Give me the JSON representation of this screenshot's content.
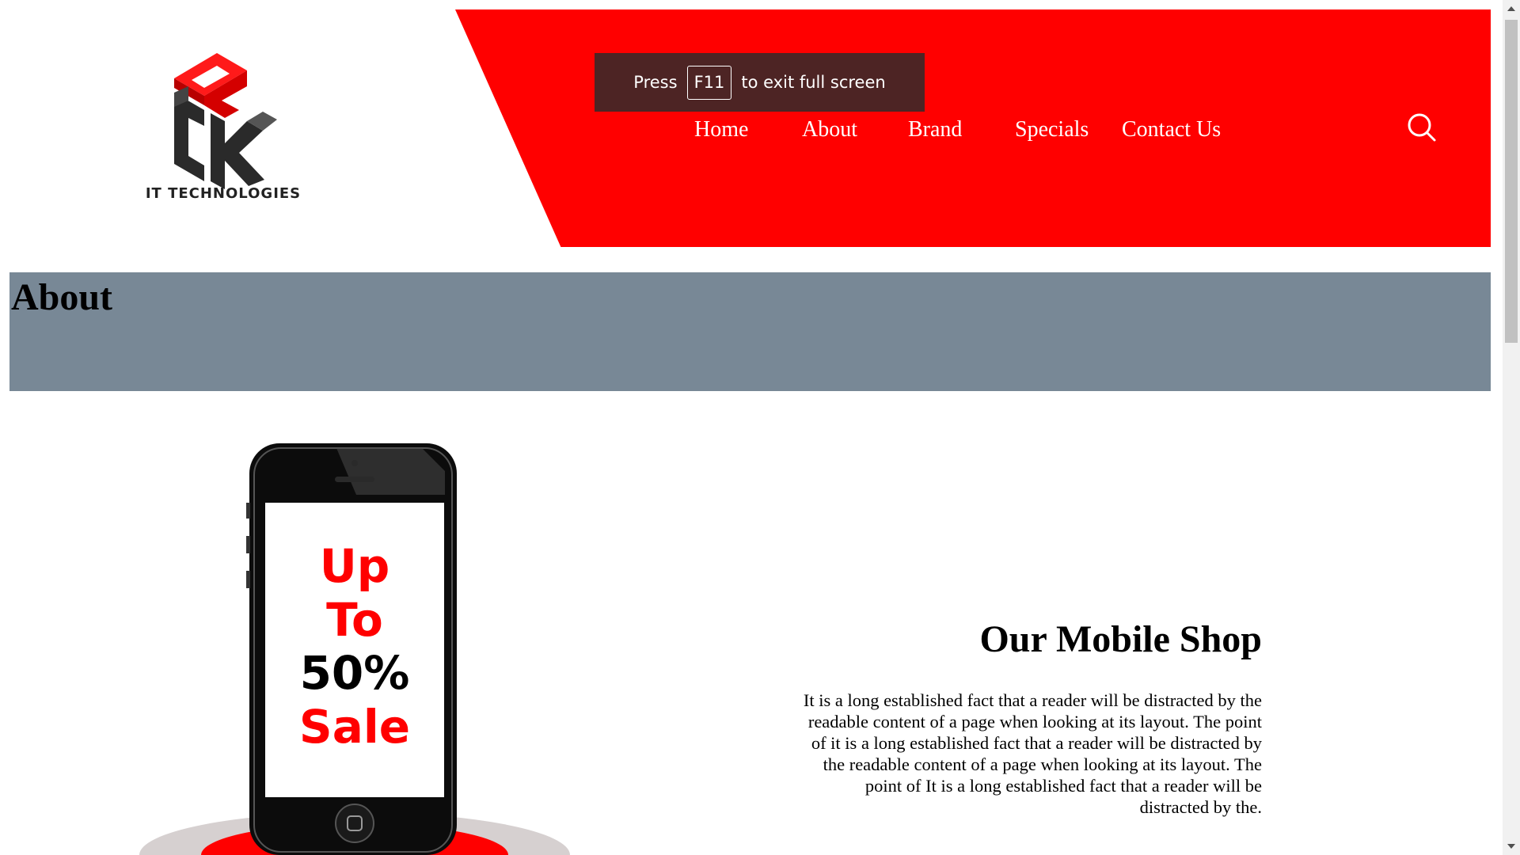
{
  "brand": {
    "logo_text": "IT TECHNOLOGIES",
    "colors": {
      "primary": "#ff0000",
      "dark": "#222222",
      "banner": "#788896"
    }
  },
  "nav": {
    "items": [
      {
        "label": "Home"
      },
      {
        "label": "About"
      },
      {
        "label": "Brand"
      },
      {
        "label": "Specials"
      },
      {
        "label": "Contact Us"
      }
    ],
    "search_icon": "search-icon"
  },
  "fullscreen_hint": {
    "press": "Press",
    "key": "F11",
    "suffix": "to exit full screen"
  },
  "page": {
    "title": "About"
  },
  "promo": {
    "lines": [
      "Up",
      "To",
      "50%",
      "Sale"
    ]
  },
  "shop": {
    "heading": "Our Mobile Shop",
    "body": "It is a long established fact that a reader will be distracted by the readable content of a page when looking at its layout. The point of it is a long established fact that a reader will be distracted by the readable content of a page when looking at its layout. The point of It is a long established fact that a reader will be distracted by the."
  }
}
